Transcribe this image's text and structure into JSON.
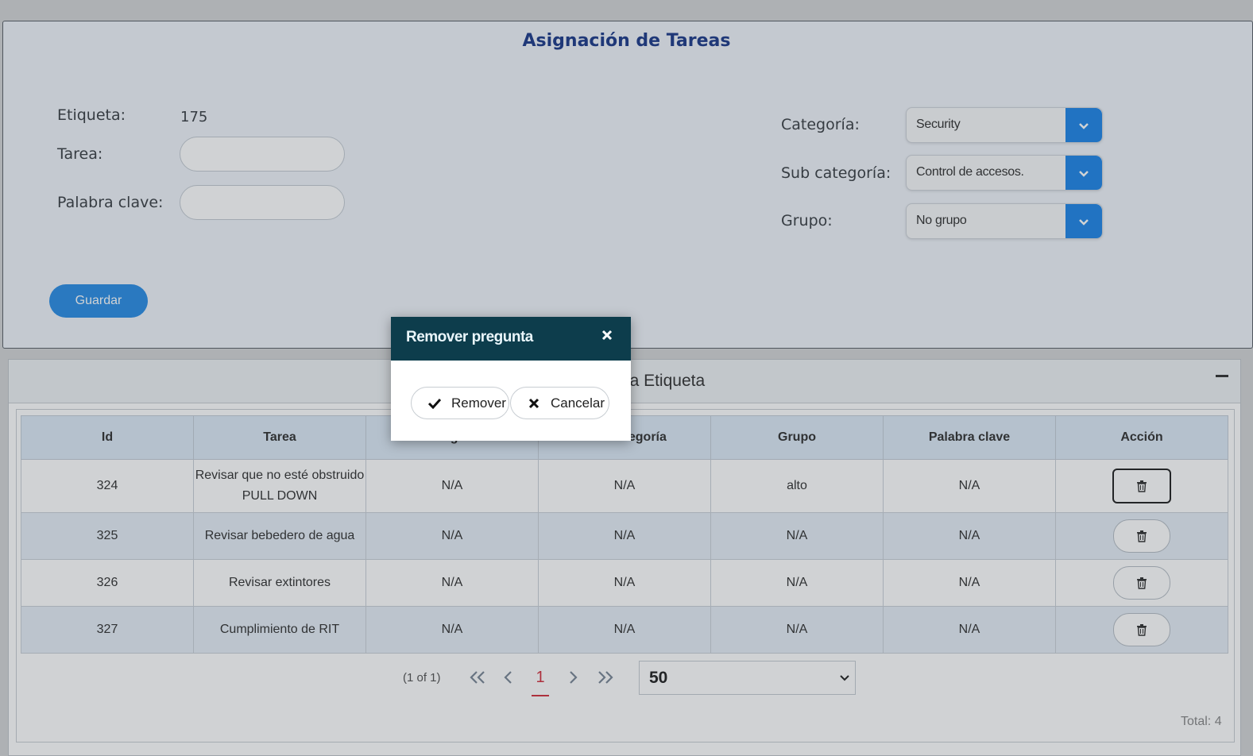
{
  "form": {
    "title": "Asignación de Tareas",
    "etiqueta_label": "Etiqueta:",
    "etiqueta_value": "175",
    "tarea_label": "Tarea:",
    "tarea_value": "",
    "palabra_label": "Palabra clave:",
    "palabra_value": "",
    "categoria_label": "Categoría:",
    "categoria_value": "Security",
    "subcategoria_label": "Sub categoría:",
    "subcategoria_value": "Control de accesos.",
    "grupo_label": "Grupo:",
    "grupo_value": "No grupo",
    "save_label": "Guardar"
  },
  "list_panel": {
    "title": "Tareas de la Etiqueta"
  },
  "table": {
    "columns": [
      "Id",
      "Tarea",
      "Categoría",
      "Sub categoría",
      "Grupo",
      "Palabra clave",
      "Acción"
    ],
    "rows": [
      {
        "id": "324",
        "tarea": "Revisar que no esté obstruido PULL DOWN",
        "categoria": "N/A",
        "subcategoria": "N/A",
        "grupo": "alto",
        "palabra": "N/A"
      },
      {
        "id": "325",
        "tarea": "Revisar bebedero de agua",
        "categoria": "N/A",
        "subcategoria": "N/A",
        "grupo": "N/A",
        "palabra": "N/A"
      },
      {
        "id": "326",
        "tarea": "Revisar extintores",
        "categoria": "N/A",
        "subcategoria": "N/A",
        "grupo": "N/A",
        "palabra": "N/A"
      },
      {
        "id": "327",
        "tarea": "Cumplimiento de RIT",
        "categoria": "N/A",
        "subcategoria": "N/A",
        "grupo": "N/A",
        "palabra": "N/A"
      }
    ]
  },
  "pager": {
    "info": "(1 of 1)",
    "current": "1",
    "rows_per_page": "50",
    "total": "Total: 4"
  },
  "modal": {
    "title": "Remover pregunta",
    "remove_label": "Remover",
    "cancel_label": "Cancelar"
  },
  "colors": {
    "accent": "#1f86e8",
    "title": "#1d3a8a",
    "modal_header": "#0d3d4c",
    "pager_active": "#d2303e"
  },
  "icons": [
    "chevron-down-icon",
    "trash-icon",
    "check-icon",
    "close-icon",
    "first-page-icon",
    "prev-page-icon",
    "next-page-icon",
    "last-page-icon",
    "minus-icon"
  ]
}
